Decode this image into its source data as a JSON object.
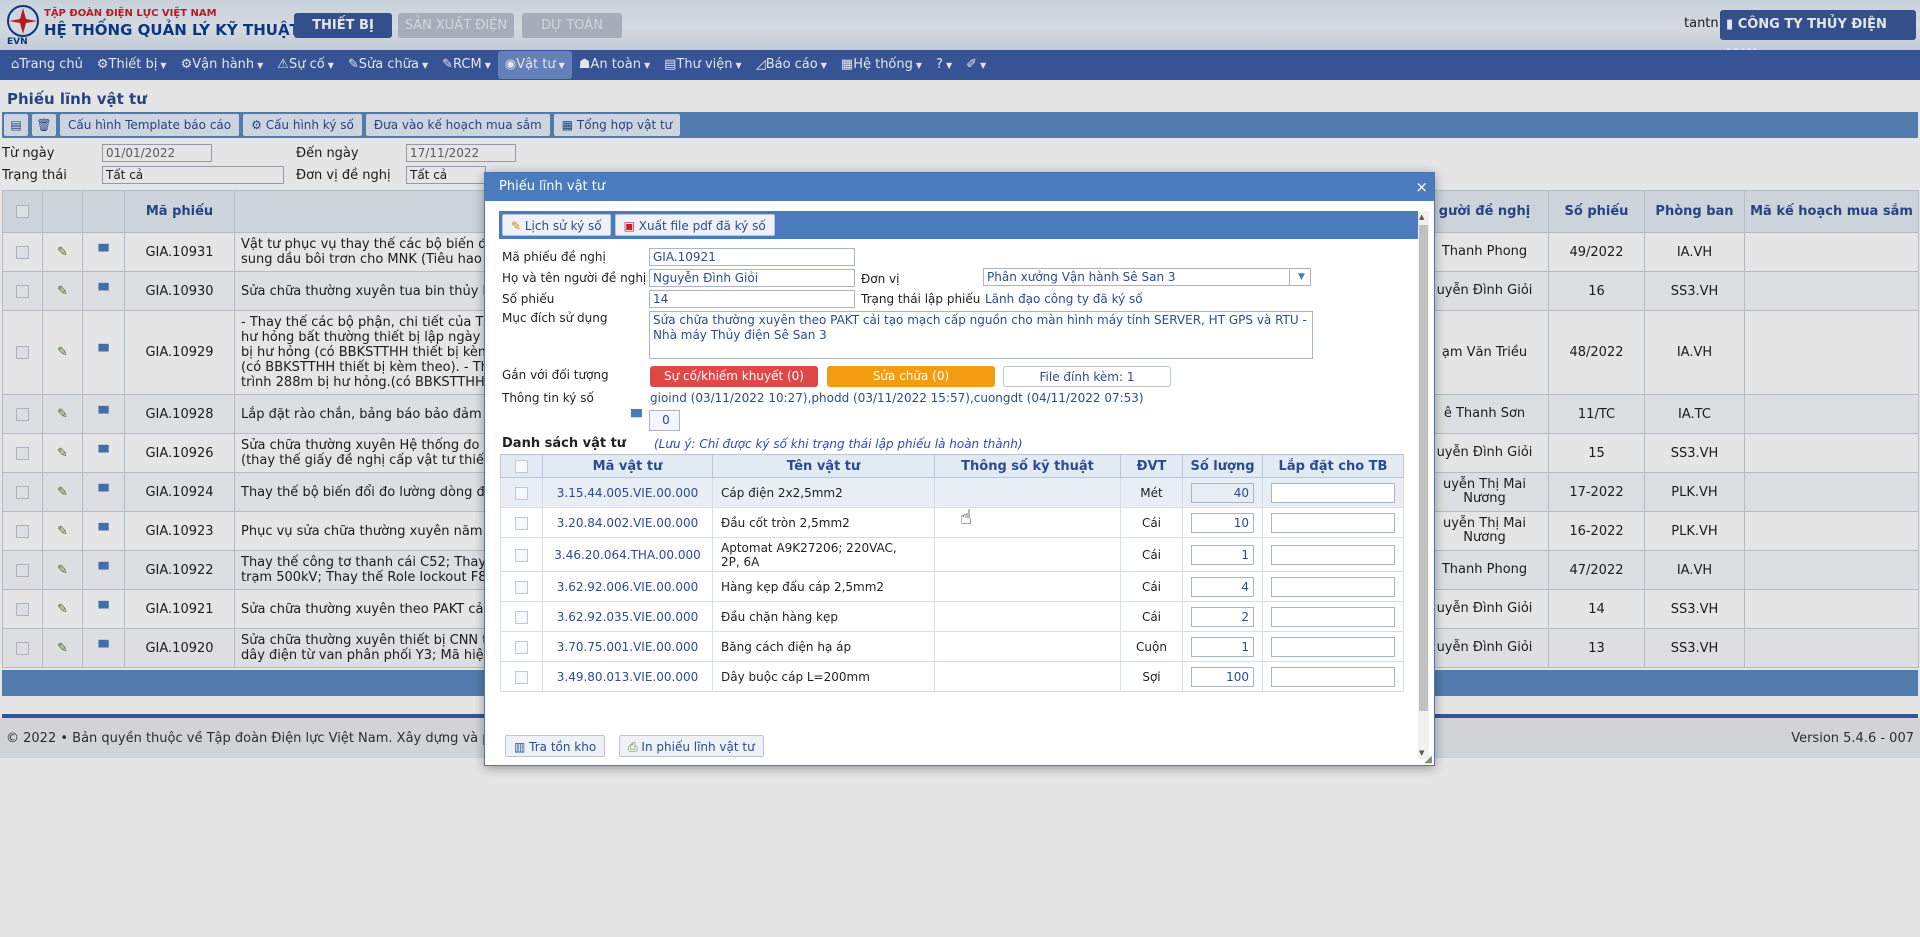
{
  "header": {
    "org": "TẬP ĐOÀN ĐIỆN LỰC VIỆT NAM",
    "system": "HỆ THỐNG QUẢN LÝ KỸ THUẬT",
    "logo_text": "EVN",
    "tabs": [
      "THIẾT BỊ",
      "SẢN XUẤT ĐIỆN",
      "DỰ TOÁN"
    ],
    "user": "tantn",
    "company": "CÔNG TY THỦY ĐIỆN IALY"
  },
  "menu": [
    "Trang chủ",
    "Thiết bị",
    "Vận hành",
    "Sự cố",
    "Sửa chữa",
    "RCM",
    "Vật tư",
    "An toàn",
    "Thư viện",
    "Báo cáo",
    "Hệ thống",
    "?"
  ],
  "page": {
    "title": "Phiếu lĩnh vật tư",
    "toolbar": [
      "Cấu hình Template báo cáo",
      "Cấu hình ký số",
      "Đưa vào kế hoạch mua sắm",
      "Tổng hợp vật tư"
    ],
    "filters": {
      "from_label": "Từ ngày",
      "from_value": "01/01/2022",
      "to_label": "Đến ngày",
      "to_value": "17/11/2022",
      "status_label": "Trạng thái",
      "status_value": "Tất cả",
      "unit_label": "Đơn vị đề nghị",
      "unit_value": "Tất cả"
    },
    "grid_headers": [
      "Mã phiếu",
      "gười đề nghị",
      "Số phiếu",
      "Phòng ban",
      "Mã kế hoạch mua sắm"
    ],
    "rows": [
      {
        "code": "GIA.10931",
        "desc": "Vật tư phục vụ thay thế các bộ biến đổi (",
        "desc2": "sung dầu bôi trơn cho MNK (Tiêu hao tro",
        "person": "Thanh Phong",
        "person2": "",
        "num": "49/2022",
        "dept": "IA.VH"
      },
      {
        "code": "GIA.10930",
        "desc": "Sửa chữa thường xuyên tua bin thủy lực",
        "desc2": "",
        "person": "uyễn Đình Giỏi",
        "person2": "",
        "num": "16",
        "dept": "SS3.VH"
      },
      {
        "code": "GIA.10929",
        "desc": "- Thay thế các bộ phận, chi tiết của Tham",
        "desc2": "hư hỏng bất thường thiết bị lập ngày 31/",
        "desc3": "bị hư hỏng (có BBKSTTHH thiết bị kèm th",
        "desc4": "(có BBKSTTHH thiết bị kèm theo). - Thay",
        "desc5": "trình 288m bị hư hỏng.(có BBKSTTHH th",
        "person": "ạm Văn Triều",
        "person2": "",
        "num": "48/2022",
        "dept": "IA.VH"
      },
      {
        "code": "GIA.10928",
        "desc": "Lắp đặt rào chắn, bảng báo bảo đảm ATC",
        "desc2": "",
        "person": "ê Thanh Sơn",
        "person2": "",
        "num": "11/TC",
        "dept": "IA.TC"
      },
      {
        "code": "GIA.10926",
        "desc": "Sửa chữa thường xuyên Hệ thống đo đến",
        "desc2": "(thay thế giấy đề nghị cấp vật tư thiết bị",
        "person": "uyễn Đình Giỏi",
        "person2": "",
        "num": "15",
        "dept": "SS3.VH"
      },
      {
        "code": "GIA.10924",
        "desc": "Thay thế bộ biến đổi đo lường dòng điện",
        "desc2": "",
        "person": "uyễn Thị Mai",
        "person2": "Nương",
        "num": "17-2022",
        "dept": "PLK.VH"
      },
      {
        "code": "GIA.10923",
        "desc": "Phục vụ sửa chữa thường xuyên năm 202",
        "desc2": "",
        "person": "uyễn Thị Mai",
        "person2": "Nương",
        "num": "16-2022",
        "dept": "PLK.VH"
      },
      {
        "code": "GIA.10922",
        "desc": "Thay thế công tơ thanh cái C52; Thay the",
        "desc2": "trạm 500kV; Thay thế Role lockout F86P",
        "person": "Thanh Phong",
        "person2": "",
        "num": "47/2022",
        "dept": "IA.VH"
      },
      {
        "code": "GIA.10921",
        "desc": "Sửa chữa thường xuyên theo PAKT cải tạ",
        "desc2": "",
        "person": "uyễn Đình Giỏi",
        "person2": "",
        "num": "14",
        "dept": "SS3.VH"
      },
      {
        "code": "GIA.10920",
        "desc": "Sửa chữa thường xuyên thiết bị CNN tổ m",
        "desc2": "dây điện từ van phân phối Y3; Mã hiệu A",
        "person": "uyễn Đình Giỏi",
        "person2": "",
        "num": "13",
        "dept": "SS3.VH"
      }
    ]
  },
  "footer": {
    "copyright": "©  2022  •  Bản quyền thuộc về Tập đoàn Điện lực Việt Nam. Xây dựng và phá",
    "version": "Version 5.4.6 - 007"
  },
  "dialog": {
    "title": "Phiếu lĩnh vật tư",
    "close": "×",
    "buttons": [
      "Lịch sử ký số",
      "Xuất file pdf đã ký số"
    ],
    "fields": {
      "code_label": "Mã phiếu đề nghị",
      "code_value": "GIA.10921",
      "person_label": "Họ và tên người đề nghị",
      "person_value": "Nguyễn Đình Giỏi",
      "unit_label": "Đơn vị",
      "unit_value": "Phân xưởng Vận hành Sê San 3",
      "num_label": "Số phiếu",
      "num_value": "14",
      "status_label": "Trạng thái lập phiếu",
      "status_value": "Lãnh đạo công ty đã ký số",
      "purpose_label": "Mục đích sử dụng",
      "purpose_value": "Sửa chữa thường xuyên theo PAKT cải tạo mạch cấp nguồn cho màn hình máy tính SERVER, HT GPS và RTU - Nhà máy Thủy điện Sê San 3",
      "link_label": "Gắn với đối tượng",
      "incident": "Sự cố/khiếm khuyết (0)",
      "repair": "Sửa chữa (0)",
      "attach": "File đính kèm: 1",
      "sign_label": "Thông tin ký số",
      "sign_value": "gioind (03/11/2022 10:27),phodd (03/11/2022 15:57),cuongdt (04/11/2022 07:53)",
      "comment_count": "0"
    },
    "list_title": "Danh sách vật tư",
    "list_note": "(Lưu ý: Chỉ được ký số khi trạng thái lập phiếu là hoàn thành)",
    "columns": [
      "Mã vật tư",
      "Tên vật tư",
      "Thông số kỹ thuật",
      "ĐVT",
      "Số lượng",
      "Lắp đặt cho TB"
    ],
    "items": [
      {
        "code": "3.15.44.005.VIE.00.000",
        "name": "Cáp điện 2x2,5mm2",
        "name2": "",
        "spec": "",
        "unit": "Mét",
        "qty": "40"
      },
      {
        "code": "3.20.84.002.VIE.00.000",
        "name": "Đầu cốt tròn 2,5mm2",
        "name2": "",
        "spec": "",
        "unit": "Cái",
        "qty": "10"
      },
      {
        "code": "3.46.20.064.THA.00.000",
        "name": "Aptomat A9K27206; 220VAC,",
        "name2": "2P, 6A",
        "spec": "",
        "unit": "Cái",
        "qty": "1"
      },
      {
        "code": "3.62.92.006.VIE.00.000",
        "name": "Hàng kẹp đấu cáp 2,5mm2",
        "name2": "",
        "spec": "",
        "unit": "Cái",
        "qty": "4"
      },
      {
        "code": "3.62.92.035.VIE.00.000",
        "name": "Đầu chặn hàng kẹp",
        "name2": "",
        "spec": "",
        "unit": "Cái",
        "qty": "2"
      },
      {
        "code": "3.70.75.001.VIE.00.000",
        "name": "Băng cách điện hạ áp",
        "name2": "",
        "spec": "",
        "unit": "Cuộn",
        "qty": "1"
      },
      {
        "code": "3.49.80.013.VIE.00.000",
        "name": "Dây buộc cáp L=200mm",
        "name2": "",
        "spec": "",
        "unit": "Sợi",
        "qty": "100"
      }
    ],
    "bottom_buttons": [
      "Tra tồn kho",
      "In phiếu lĩnh vật tư"
    ]
  },
  "colors": {
    "brand": "#3b5da6",
    "dialog_header": "#4a7bbd",
    "incident": "#e04848",
    "repair": "#f39c12"
  }
}
